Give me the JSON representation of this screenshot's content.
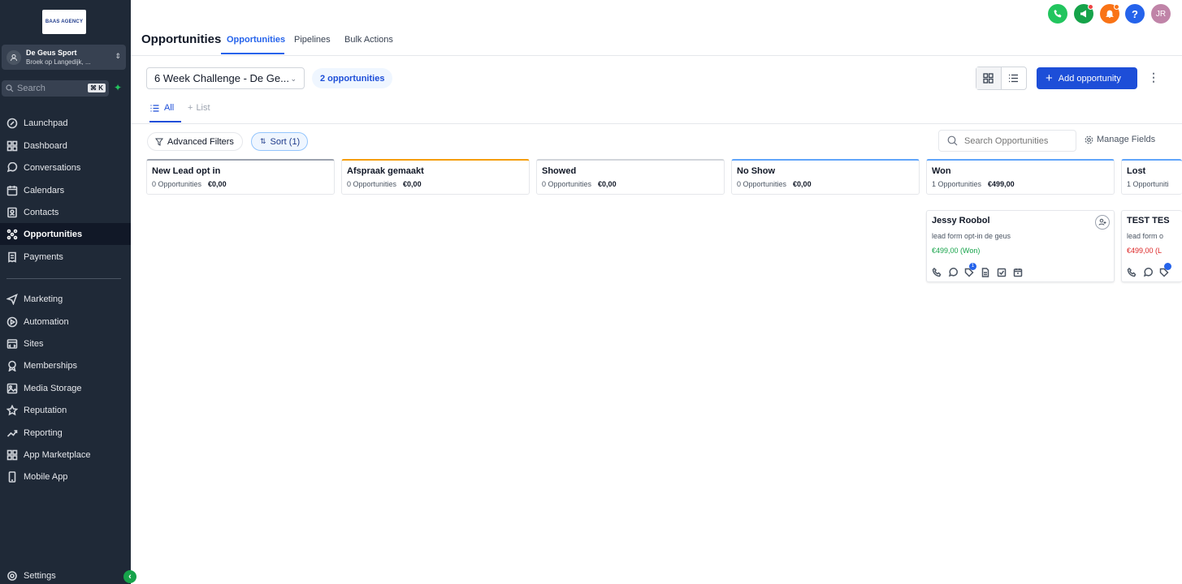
{
  "sidebar": {
    "logo_text": "BAAS AGENCY",
    "account": {
      "name": "De Geus Sport",
      "location": "Broek op Langedijk, ..."
    },
    "search": {
      "placeholder": "Search",
      "shortcut": "⌘ K"
    },
    "items": [
      {
        "label": "Launchpad",
        "icon": "rocket-icon"
      },
      {
        "label": "Dashboard",
        "icon": "dashboard-icon"
      },
      {
        "label": "Conversations",
        "icon": "chat-icon"
      },
      {
        "label": "Calendars",
        "icon": "calendar-icon"
      },
      {
        "label": "Contacts",
        "icon": "contacts-icon"
      },
      {
        "label": "Opportunities",
        "icon": "opportunities-icon",
        "active": true
      },
      {
        "label": "Payments",
        "icon": "payments-icon"
      },
      {
        "label": "Marketing",
        "icon": "send-icon"
      },
      {
        "label": "Automation",
        "icon": "automation-icon"
      },
      {
        "label": "Sites",
        "icon": "sites-icon"
      },
      {
        "label": "Memberships",
        "icon": "memberships-icon"
      },
      {
        "label": "Media Storage",
        "icon": "media-icon"
      },
      {
        "label": "Reputation",
        "icon": "star-icon"
      },
      {
        "label": "Reporting",
        "icon": "chart-icon"
      },
      {
        "label": "App Marketplace",
        "icon": "grid-icon"
      },
      {
        "label": "Mobile App",
        "icon": "mobile-icon"
      },
      {
        "label": "Settings",
        "icon": "gear-icon"
      }
    ]
  },
  "header": {
    "title": "Opportunities",
    "tabs": [
      "Opportunities",
      "Pipelines",
      "Bulk Actions"
    ],
    "avatar_initials": "JR",
    "icon_colors": {
      "phone": "#22c55e",
      "megaphone": "#16a34a",
      "bell": "#f97316",
      "help": "#2563eb",
      "avatar": "#c084a8"
    }
  },
  "toolbar": {
    "pipeline": "6 Week Challenge - De Ge...",
    "opportunity_count": "2 opportunities",
    "add_label": "Add opportunity"
  },
  "subtabs": {
    "all": "All",
    "list": "List"
  },
  "filters": {
    "advanced": "Advanced Filters",
    "sort": "Sort (1)",
    "search_placeholder": "Search Opportunities",
    "manage_fields": "Manage Fields"
  },
  "columns": [
    {
      "name": "New Lead opt in",
      "count": "0 Opportunities",
      "total": "€0,00",
      "color": "#6b7280"
    },
    {
      "name": "Afspraak gemaakt",
      "count": "0 Opportunities",
      "total": "€0,00",
      "color": "#f59e0b"
    },
    {
      "name": "Showed",
      "count": "0 Opportunities",
      "total": "€0,00",
      "color": "#6b7280"
    },
    {
      "name": "No Show",
      "count": "0 Opportunities",
      "total": "€0,00",
      "color": "#60a5fa"
    },
    {
      "name": "Won",
      "count": "1 Opportunities",
      "total": "€499,00",
      "color": "#60a5fa"
    },
    {
      "name": "Lost",
      "count": "1 Opportuniti",
      "total": "",
      "color": "#60a5fa"
    }
  ],
  "cards": [
    {
      "name": "Jessy Roobol",
      "source": "lead form opt-in de geus",
      "value": "€499,00 (Won)",
      "value_color": "#16a34a",
      "badge": "1"
    },
    {
      "name": "TEST TES",
      "source": "lead form o",
      "value": "€499,00 (L",
      "value_color": "#dc2626",
      "badge": ""
    }
  ]
}
